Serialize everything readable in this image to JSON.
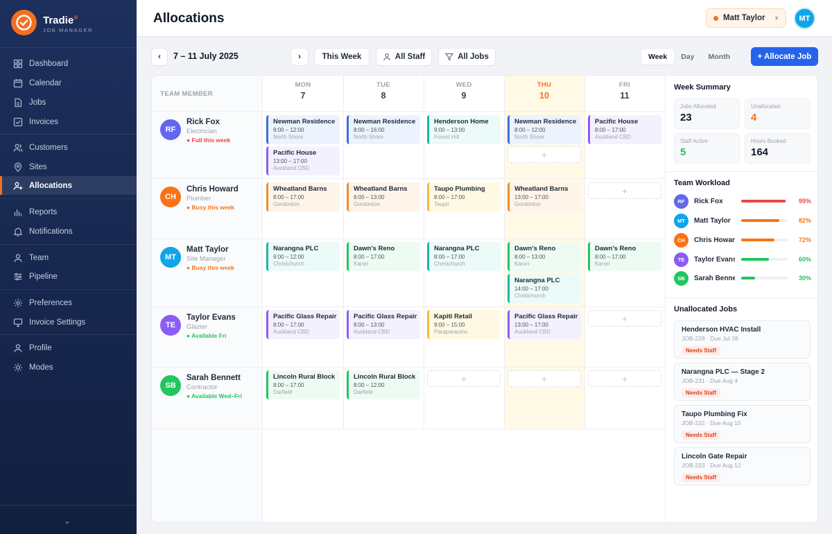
{
  "app": {
    "name": "Tradie",
    "subtitle": "JOB MANAGER"
  },
  "nav": {
    "items": [
      {
        "label": "Dashboard",
        "icon": "dashboard-icon"
      },
      {
        "label": "Calendar",
        "icon": "calendar-icon"
      },
      {
        "label": "Jobs",
        "icon": "jobs-icon"
      },
      {
        "label": "Invoices",
        "icon": "invoices-icon"
      },
      {
        "label": "Customers",
        "icon": "customers-icon"
      },
      {
        "label": "Sites",
        "icon": "location-icon"
      },
      {
        "label": "Allocations",
        "icon": "allocations-icon",
        "active": true
      },
      {
        "label": "Reports",
        "icon": "reports-icon"
      },
      {
        "label": "Notifications",
        "icon": "bell-icon"
      },
      {
        "label": "Team",
        "icon": "team-icon"
      },
      {
        "label": "Pipeline",
        "icon": "pipeline-icon"
      },
      {
        "label": "Preferences",
        "icon": "gear-icon"
      },
      {
        "label": "Invoice Settings",
        "icon": "monitor-icon"
      },
      {
        "label": "Profile",
        "icon": "user-icon"
      },
      {
        "label": "Modes",
        "icon": "sun-icon"
      }
    ]
  },
  "header": {
    "title": "Allocations",
    "user_name": "Matt Taylor",
    "user_initials": "MT"
  },
  "toolbar": {
    "date_range": "7 – 11 July 2025",
    "this_week": "This Week",
    "all_staff": "All Staff",
    "all_jobs": "All Jobs",
    "views": [
      "Week",
      "Day",
      "Month"
    ],
    "active_view": "Week",
    "allocate_label": "+ Allocate Job"
  },
  "schedule": {
    "member_header": "TEAM MEMBER",
    "days": [
      {
        "name": "MON",
        "date": "7"
      },
      {
        "name": "TUE",
        "date": "8"
      },
      {
        "name": "WED",
        "date": "9"
      },
      {
        "name": "THU",
        "date": "10",
        "today": true
      },
      {
        "name": "FRI",
        "date": "11"
      }
    ],
    "members": [
      {
        "initials": "RF",
        "name": "Rick Fox",
        "role": "Electrician",
        "status": "● Full this week",
        "avatar_color": "#6366f1",
        "status_color": "#ef4444"
      },
      {
        "initials": "CH",
        "name": "Chris Howard",
        "role": "Plumber",
        "status": "● Busy this week",
        "avatar_color": "#f97316",
        "status_color": "#f97316"
      },
      {
        "initials": "MT",
        "name": "Matt Taylor",
        "role": "Site Manager",
        "status": "● Busy this week",
        "avatar_color": "#0ea5e9",
        "status_color": "#f97316"
      },
      {
        "initials": "TE",
        "name": "Taylor Evans",
        "role": "Glazier",
        "status": "● Available Fri",
        "avatar_color": "#8b5cf6",
        "status_color": "#22c55e"
      },
      {
        "initials": "SB",
        "name": "Sarah Bennett",
        "role": "Contractor",
        "status": "● Available Wed–Fri",
        "avatar_color": "#22c55e",
        "status_color": "#22c55e"
      }
    ],
    "cards": [
      {
        "title": "Newman Residence",
        "time": "8:00 – 12:00",
        "loc": "North Shore"
      },
      {
        "title": "Pacific House",
        "time": "13:00 – 17:00",
        "loc": "Auckland CBD"
      },
      {
        "title": "Newman Residence",
        "time": "8:00 – 16:00",
        "loc": "North Shore"
      },
      {
        "title": "Henderson Home",
        "time": "9:00 – 13:00",
        "loc": "Forest Hill"
      },
      {
        "title": "Newman Residence",
        "time": "8:00 – 12:00",
        "loc": "North Shore"
      },
      {
        "title": "Pacific House",
        "time": "8:00 – 17:00",
        "loc": "Auckland CBD"
      },
      {
        "title": "Wheatland Barns",
        "time": "8:00 – 17:00",
        "loc": "Gordonton"
      },
      {
        "title": "Wheatland Barns",
        "time": "8:00 – 13:00",
        "loc": "Gordonton"
      },
      {
        "title": "Taupo Plumbing",
        "time": "8:00 – 17:00",
        "loc": "Taupo"
      },
      {
        "title": "Wheatland Barns",
        "time": "13:00 – 17:00",
        "loc": "Gordonton"
      },
      {
        "title": "Narangna PLC",
        "time": "9:00 – 12:00",
        "loc": "Christchurch"
      },
      {
        "title": "Dawn's Reno",
        "time": "8:00 – 17:00",
        "loc": "Karori"
      },
      {
        "title": "Narangna PLC",
        "time": "8:00 – 17:00",
        "loc": "Christchurch"
      },
      {
        "title": "Dawn's Reno",
        "time": "8:00 – 13:00",
        "loc": "Karori"
      },
      {
        "title": "Narangna PLC",
        "time": "14:00 – 17:00",
        "loc": "Christchurch"
      },
      {
        "title": "Dawn's Reno",
        "time": "8:00 – 17:00",
        "loc": "Karori"
      },
      {
        "title": "Pacific Glass Repair",
        "time": "8:00 – 17:00",
        "loc": "Auckland CBD"
      },
      {
        "title": "Pacific Glass Repair",
        "time": "8:00 – 13:00",
        "loc": "Auckland CBD"
      },
      {
        "title": "Kapiti Retail",
        "time": "9:00 – 15:00",
        "loc": "Paraparaumu"
      },
      {
        "title": "Pacific Glass Repair",
        "time": "13:00 – 17:00",
        "loc": "Auckland CBD"
      },
      {
        "title": "Lincoln Rural Block",
        "time": "8:00 – 17:00",
        "loc": "Darfield"
      },
      {
        "title": "Lincoln Rural Block",
        "time": "8:00 – 12:00",
        "loc": "Darfield"
      }
    ],
    "empty_slot": "+"
  },
  "summary": {
    "title": "Week Summary",
    "stats": [
      {
        "label": "Jobs Allocated",
        "value": "23",
        "color": "#111827"
      },
      {
        "label": "Unallocated",
        "value": "4",
        "color": "#f97316"
      },
      {
        "label": "Staff Active",
        "value": "5",
        "color": "#22c55e"
      },
      {
        "label": "Hours Booked",
        "value": "164",
        "color": "#111827"
      }
    ]
  },
  "workload": {
    "title": "Team Workload",
    "items": [
      {
        "initials": "RF",
        "name": "Rick Fox",
        "pct_label": "95%",
        "pct": 0.95,
        "color": "#ef4444",
        "avatar_color": "#6366f1"
      },
      {
        "initials": "MT",
        "name": "Matt Taylor",
        "pct_label": "82%",
        "pct": 0.82,
        "color": "#f97316",
        "avatar_color": "#0ea5e9"
      },
      {
        "initials": "CH",
        "name": "Chris Howard",
        "pct_label": "72%",
        "pct": 0.72,
        "color": "#f97316",
        "avatar_color": "#f97316"
      },
      {
        "initials": "TE",
        "name": "Taylor Evans",
        "pct_label": "60%",
        "pct": 0.6,
        "color": "#22c55e",
        "avatar_color": "#8b5cf6"
      },
      {
        "initials": "SB",
        "name": "Sarah Bennett",
        "pct_label": "30%",
        "pct": 0.3,
        "color": "#22c55e",
        "avatar_color": "#22c55e"
      }
    ]
  },
  "unallocated": {
    "title": "Unallocated Jobs",
    "items": [
      {
        "title": "Henderson HVAC Install",
        "sub": "JOB-229 · Due Jul 28",
        "badge": "Needs Staff"
      },
      {
        "title": "Narangna PLC — Stage 2",
        "sub": "JOB-231 · Due Aug 4",
        "badge": "Needs Staff"
      },
      {
        "title": "Taupo Plumbing Fix",
        "sub": "JOB-232 · Due Aug 10",
        "badge": "Needs Staff"
      },
      {
        "title": "Lincoln Gate Repair",
        "sub": "JOB-233 · Due Aug 12",
        "badge": "Needs Staff"
      }
    ]
  }
}
